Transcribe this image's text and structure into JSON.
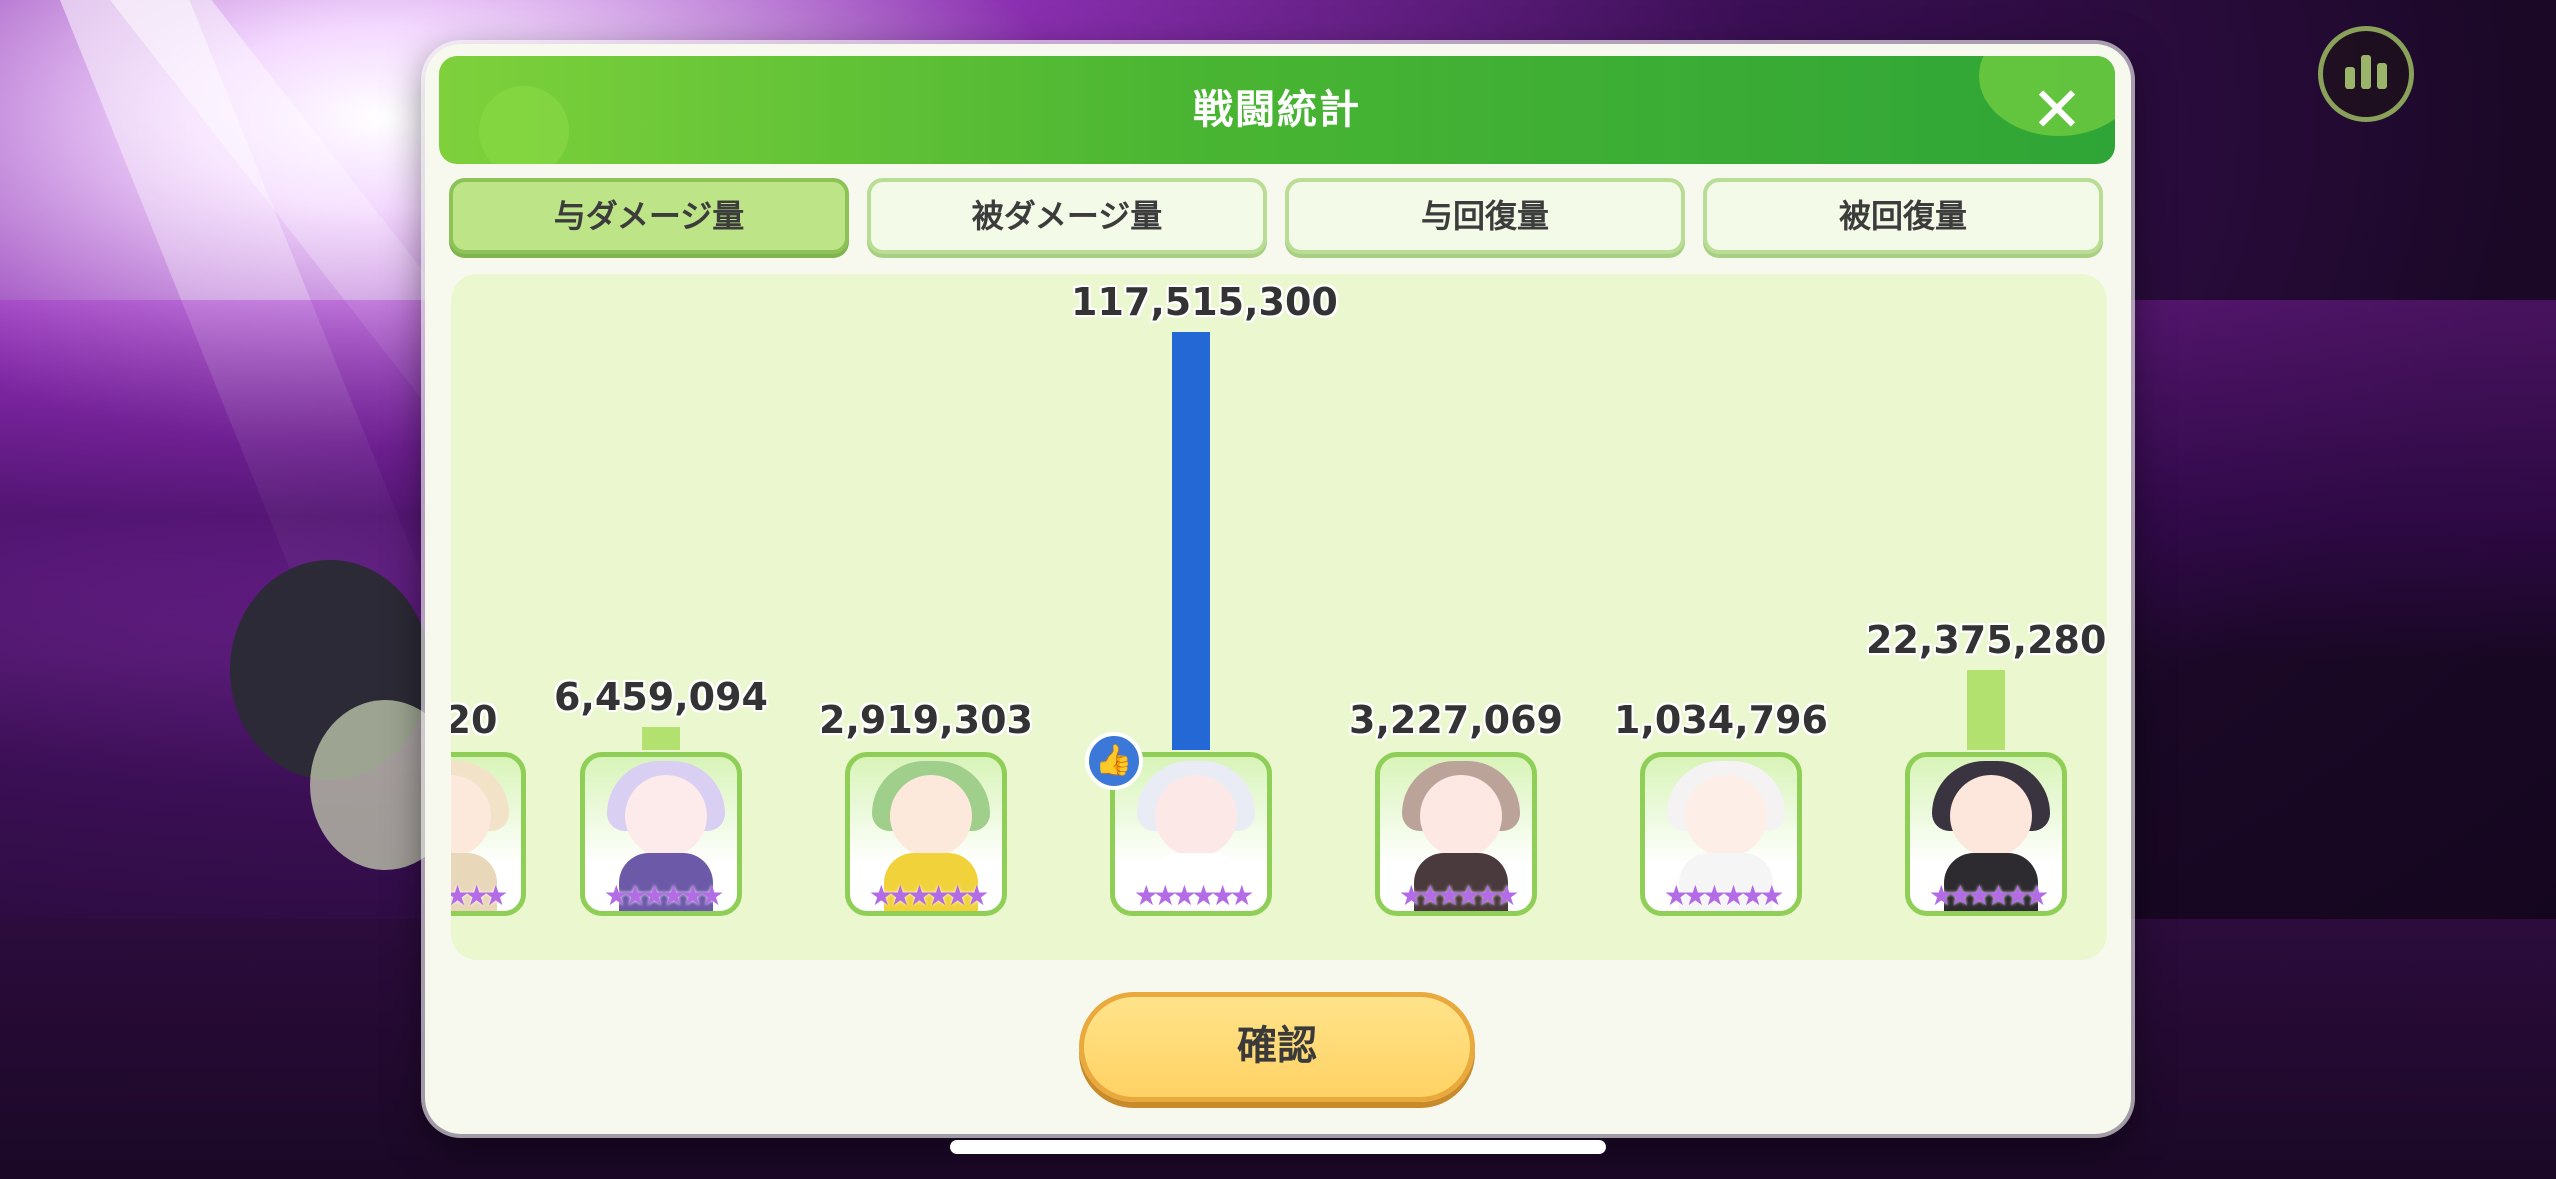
{
  "header": {
    "title": "戦闘統計",
    "close_label": "✕"
  },
  "tabs": [
    {
      "label": "与ダメージ量",
      "active": true
    },
    {
      "label": "被ダメージ量",
      "active": false
    },
    {
      "label": "与回復量",
      "active": false
    },
    {
      "label": "被回復量",
      "active": false
    }
  ],
  "chart_data": {
    "type": "bar",
    "title": "",
    "categories": [
      "",
      "",
      "",
      "",
      "",
      "",
      ""
    ],
    "series": [
      {
        "values": [
          null,
          6459094,
          2919303,
          117515300,
          3227069,
          1034796,
          22375280
        ]
      }
    ],
    "value_labels": [
      "20",
      "6,459,094",
      "2,919,303",
      "117,515,300",
      "3,227,069",
      "1,034,796",
      "22,375,280"
    ],
    "highlight_index": 3,
    "colors": {
      "highlight": "#2468d6",
      "default": "#b2e170"
    },
    "grid": false
  },
  "characters": [
    {
      "stars": "★★★★★★",
      "hair": "#f2e3c8",
      "skin": "#fde8dc",
      "body": "#e8d7b8"
    },
    {
      "stars": "★★★★★★",
      "hair": "#d9cff2",
      "skin": "#fdeaea",
      "body": "#6c5aa8"
    },
    {
      "stars": "★★★★★★",
      "hair": "#9fcf8a",
      "skin": "#fde8dc",
      "body": "#f2d23a"
    },
    {
      "stars": "★★★★★★",
      "hair": "#e9ecf4",
      "skin": "#fde8e8",
      "body": "#ffffff"
    },
    {
      "stars": "★★★★★★",
      "hair": "#bba39a",
      "skin": "#fde8e3",
      "body": "#4a3a3e"
    },
    {
      "stars": "★★★★★★",
      "hair": "#f4f2f2",
      "skin": "#fdeee8",
      "body": "#f5f5f5"
    },
    {
      "stars": "★★★★★★",
      "hair": "#3a3340",
      "skin": "#fde6dc",
      "body": "#2d2a30"
    }
  ],
  "mvp_badge": "👍",
  "confirm_label": "確認"
}
